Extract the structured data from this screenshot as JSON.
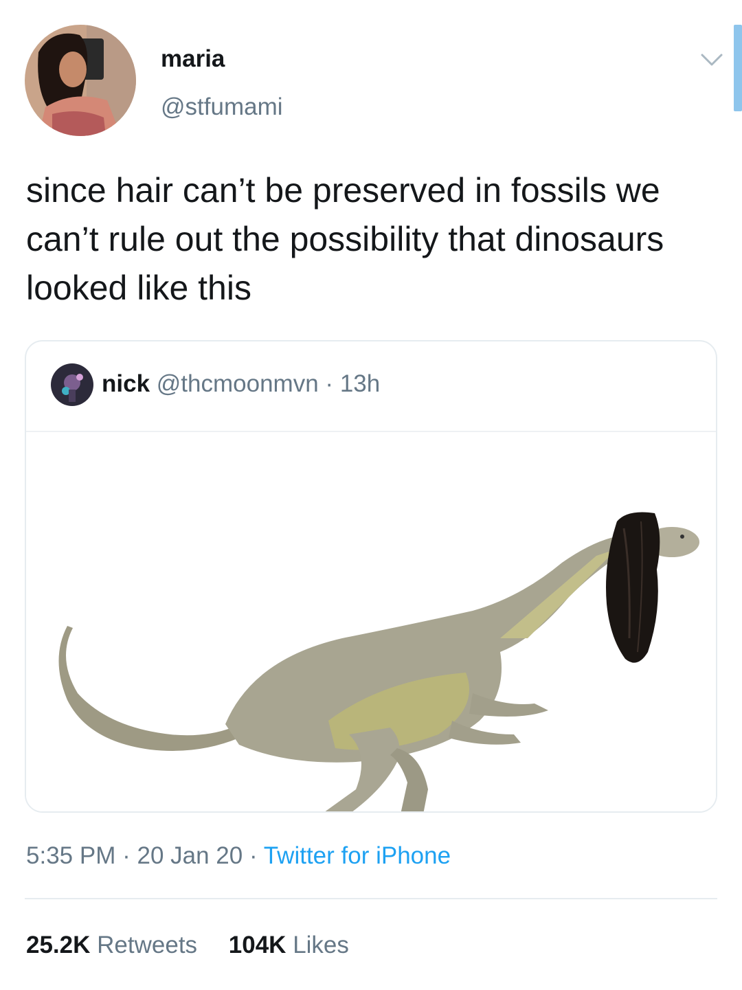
{
  "author": {
    "display_name": "maria",
    "handle": "@stfumami"
  },
  "tweet": {
    "text": "since hair can’t be preserved in fossils we can’t rule out the possibility that dinosaurs looked like this"
  },
  "quoted_tweet": {
    "display_name": "nick",
    "handle": "@thcmoonmvn",
    "separator": "·",
    "time": "13h",
    "image": "dinosaur-with-long-black-hair-illustration"
  },
  "meta": {
    "time": "5:35 PM",
    "separator_1": "·",
    "date": "20 Jan 20",
    "separator_2": "·",
    "source": "Twitter for iPhone"
  },
  "stats": {
    "retweets_count": "25.2K",
    "retweets_label": "Retweets",
    "likes_count": "104K",
    "likes_label": "Likes"
  },
  "colors": {
    "text_primary": "#14171a",
    "text_secondary": "#657786",
    "link": "#1da1f2",
    "border": "#e6ecf0"
  },
  "icons": [
    "chevron-down-icon"
  ]
}
